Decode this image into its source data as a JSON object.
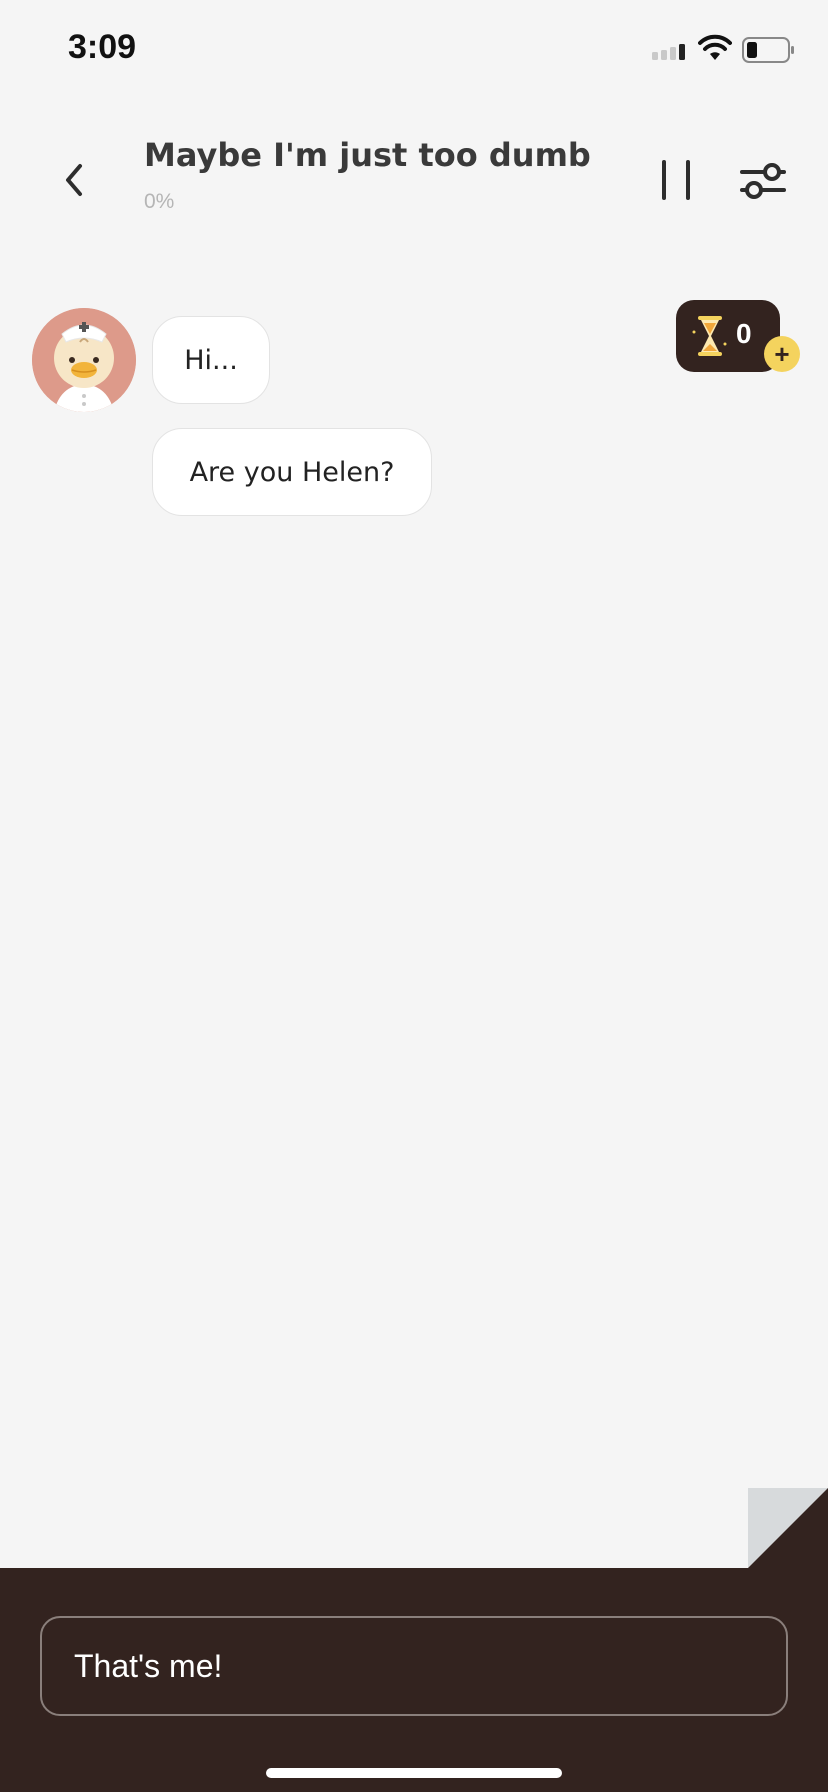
{
  "status_bar": {
    "time": "3:09"
  },
  "header": {
    "title": "Maybe I'm just too dumb",
    "progress": "0%"
  },
  "messages": [
    {
      "text": "Hi..."
    },
    {
      "text": "Are you Helen?"
    }
  ],
  "timer": {
    "count": "0",
    "add_label": "+"
  },
  "reply_option": {
    "text": "That's me!"
  },
  "colors": {
    "background": "#f5f5f5",
    "panel": "#33231f",
    "avatar_bg": "#dd9a8a",
    "accent_yellow": "#f4d35e"
  },
  "icons": [
    "signal-icon",
    "wifi-icon",
    "battery-icon",
    "back-chevron-icon",
    "pause-icon",
    "sliders-icon",
    "hourglass-icon",
    "plus-icon"
  ]
}
